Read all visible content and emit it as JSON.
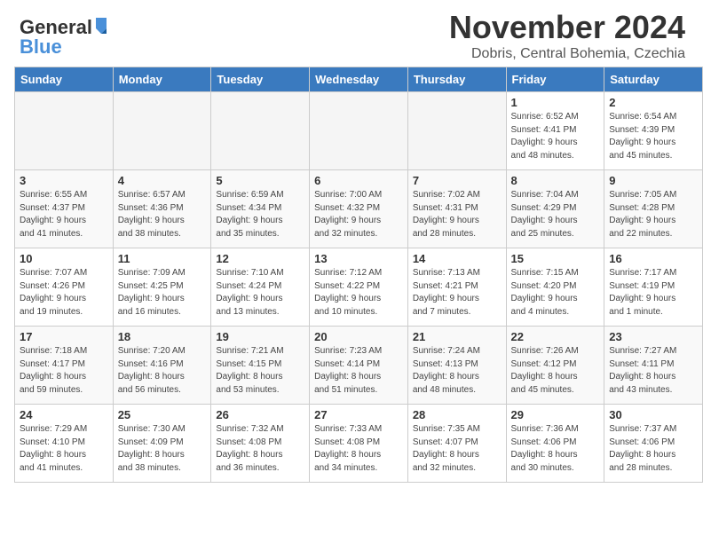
{
  "header": {
    "logo_line1": "General",
    "logo_line2": "Blue",
    "title": "November 2024",
    "subtitle": "Dobris, Central Bohemia, Czechia"
  },
  "calendar": {
    "days_of_week": [
      "Sunday",
      "Monday",
      "Tuesday",
      "Wednesday",
      "Thursday",
      "Friday",
      "Saturday"
    ],
    "weeks": [
      [
        {
          "day": "",
          "info": ""
        },
        {
          "day": "",
          "info": ""
        },
        {
          "day": "",
          "info": ""
        },
        {
          "day": "",
          "info": ""
        },
        {
          "day": "",
          "info": ""
        },
        {
          "day": "1",
          "info": "Sunrise: 6:52 AM\nSunset: 4:41 PM\nDaylight: 9 hours\nand 48 minutes."
        },
        {
          "day": "2",
          "info": "Sunrise: 6:54 AM\nSunset: 4:39 PM\nDaylight: 9 hours\nand 45 minutes."
        }
      ],
      [
        {
          "day": "3",
          "info": "Sunrise: 6:55 AM\nSunset: 4:37 PM\nDaylight: 9 hours\nand 41 minutes."
        },
        {
          "day": "4",
          "info": "Sunrise: 6:57 AM\nSunset: 4:36 PM\nDaylight: 9 hours\nand 38 minutes."
        },
        {
          "day": "5",
          "info": "Sunrise: 6:59 AM\nSunset: 4:34 PM\nDaylight: 9 hours\nand 35 minutes."
        },
        {
          "day": "6",
          "info": "Sunrise: 7:00 AM\nSunset: 4:32 PM\nDaylight: 9 hours\nand 32 minutes."
        },
        {
          "day": "7",
          "info": "Sunrise: 7:02 AM\nSunset: 4:31 PM\nDaylight: 9 hours\nand 28 minutes."
        },
        {
          "day": "8",
          "info": "Sunrise: 7:04 AM\nSunset: 4:29 PM\nDaylight: 9 hours\nand 25 minutes."
        },
        {
          "day": "9",
          "info": "Sunrise: 7:05 AM\nSunset: 4:28 PM\nDaylight: 9 hours\nand 22 minutes."
        }
      ],
      [
        {
          "day": "10",
          "info": "Sunrise: 7:07 AM\nSunset: 4:26 PM\nDaylight: 9 hours\nand 19 minutes."
        },
        {
          "day": "11",
          "info": "Sunrise: 7:09 AM\nSunset: 4:25 PM\nDaylight: 9 hours\nand 16 minutes."
        },
        {
          "day": "12",
          "info": "Sunrise: 7:10 AM\nSunset: 4:24 PM\nDaylight: 9 hours\nand 13 minutes."
        },
        {
          "day": "13",
          "info": "Sunrise: 7:12 AM\nSunset: 4:22 PM\nDaylight: 9 hours\nand 10 minutes."
        },
        {
          "day": "14",
          "info": "Sunrise: 7:13 AM\nSunset: 4:21 PM\nDaylight: 9 hours\nand 7 minutes."
        },
        {
          "day": "15",
          "info": "Sunrise: 7:15 AM\nSunset: 4:20 PM\nDaylight: 9 hours\nand 4 minutes."
        },
        {
          "day": "16",
          "info": "Sunrise: 7:17 AM\nSunset: 4:19 PM\nDaylight: 9 hours\nand 1 minute."
        }
      ],
      [
        {
          "day": "17",
          "info": "Sunrise: 7:18 AM\nSunset: 4:17 PM\nDaylight: 8 hours\nand 59 minutes."
        },
        {
          "day": "18",
          "info": "Sunrise: 7:20 AM\nSunset: 4:16 PM\nDaylight: 8 hours\nand 56 minutes."
        },
        {
          "day": "19",
          "info": "Sunrise: 7:21 AM\nSunset: 4:15 PM\nDaylight: 8 hours\nand 53 minutes."
        },
        {
          "day": "20",
          "info": "Sunrise: 7:23 AM\nSunset: 4:14 PM\nDaylight: 8 hours\nand 51 minutes."
        },
        {
          "day": "21",
          "info": "Sunrise: 7:24 AM\nSunset: 4:13 PM\nDaylight: 8 hours\nand 48 minutes."
        },
        {
          "day": "22",
          "info": "Sunrise: 7:26 AM\nSunset: 4:12 PM\nDaylight: 8 hours\nand 45 minutes."
        },
        {
          "day": "23",
          "info": "Sunrise: 7:27 AM\nSunset: 4:11 PM\nDaylight: 8 hours\nand 43 minutes."
        }
      ],
      [
        {
          "day": "24",
          "info": "Sunrise: 7:29 AM\nSunset: 4:10 PM\nDaylight: 8 hours\nand 41 minutes."
        },
        {
          "day": "25",
          "info": "Sunrise: 7:30 AM\nSunset: 4:09 PM\nDaylight: 8 hours\nand 38 minutes."
        },
        {
          "day": "26",
          "info": "Sunrise: 7:32 AM\nSunset: 4:08 PM\nDaylight: 8 hours\nand 36 minutes."
        },
        {
          "day": "27",
          "info": "Sunrise: 7:33 AM\nSunset: 4:08 PM\nDaylight: 8 hours\nand 34 minutes."
        },
        {
          "day": "28",
          "info": "Sunrise: 7:35 AM\nSunset: 4:07 PM\nDaylight: 8 hours\nand 32 minutes."
        },
        {
          "day": "29",
          "info": "Sunrise: 7:36 AM\nSunset: 4:06 PM\nDaylight: 8 hours\nand 30 minutes."
        },
        {
          "day": "30",
          "info": "Sunrise: 7:37 AM\nSunset: 4:06 PM\nDaylight: 8 hours\nand 28 minutes."
        }
      ]
    ]
  }
}
